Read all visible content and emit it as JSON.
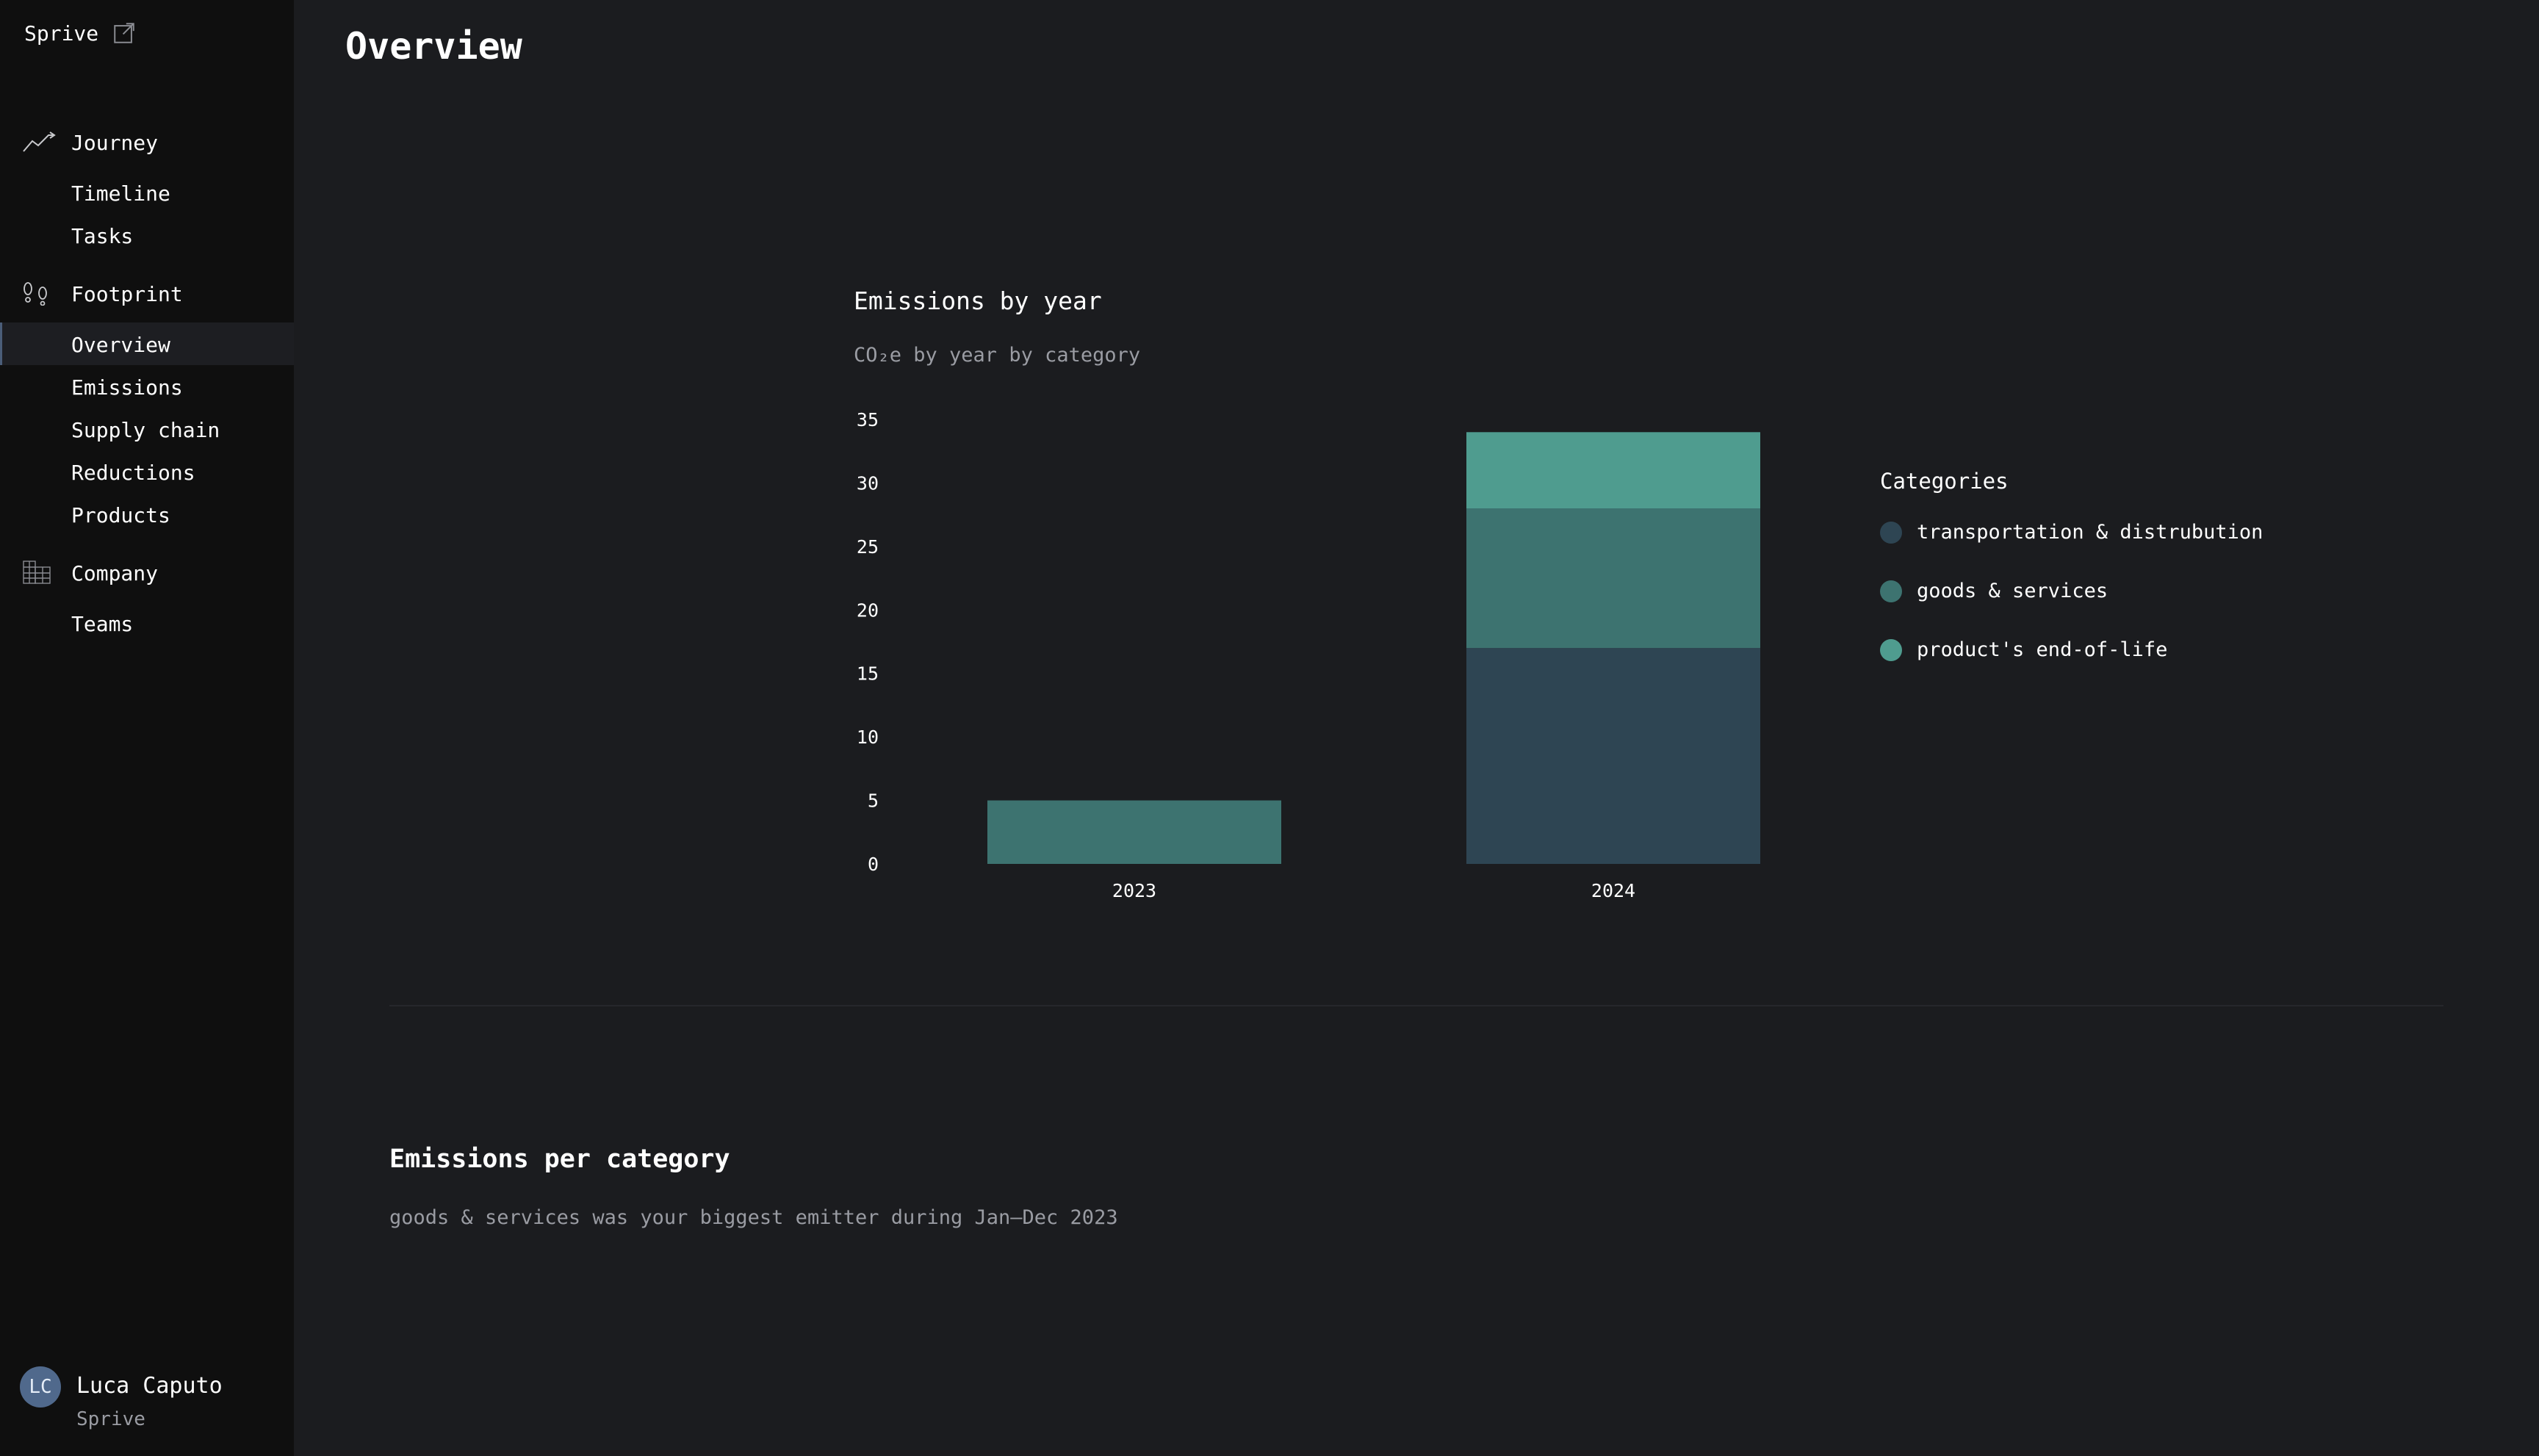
{
  "sidebar": {
    "brand": "Sprive",
    "groups": [
      {
        "label": "Journey",
        "icon": "trend-line-icon",
        "items": [
          "Timeline",
          "Tasks"
        ]
      },
      {
        "label": "Footprint",
        "icon": "footprints-icon",
        "items": [
          "Overview",
          "Emissions",
          "Supply chain",
          "Reductions",
          "Products"
        ]
      },
      {
        "label": "Company",
        "icon": "building-icon",
        "items": [
          "Teams"
        ]
      }
    ],
    "active_item": "Overview"
  },
  "user": {
    "initials": "LC",
    "name": "Luca Caputo",
    "org": "Sprive"
  },
  "page": {
    "title": "Overview"
  },
  "chart_section": {
    "title": "Emissions by year",
    "subtitle": "CO₂e by year by category",
    "legend_title": "Categories"
  },
  "chart_data": {
    "type": "bar",
    "stacked": true,
    "categories": [
      "2023",
      "2024"
    ],
    "series": [
      {
        "name": "transportation & distrubution",
        "color": "#2e4553",
        "values": [
          0,
          17
        ]
      },
      {
        "name": "goods & services",
        "color": "#3d7370",
        "values": [
          5,
          11
        ]
      },
      {
        "name": "product's end-of-life",
        "color": "#4f9c8f",
        "values": [
          0,
          6
        ]
      }
    ],
    "yticks": [
      0,
      5,
      10,
      15,
      20,
      25,
      30,
      35
    ],
    "ylim": [
      0,
      35
    ],
    "grid": false,
    "legend_position": "right"
  },
  "category_section": {
    "title": "Emissions per category",
    "text": "goods & services was your biggest emitter during Jan–Dec 2023"
  },
  "colors": {
    "background": "#1b1c1f",
    "sidebar": "#0f0f0f",
    "muted_text": "#9a9ca3",
    "avatar": "#50698c"
  }
}
